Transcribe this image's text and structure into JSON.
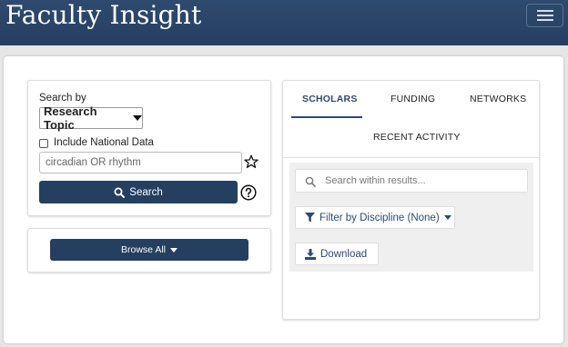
{
  "app": {
    "title": "Faculty Insight"
  },
  "search": {
    "search_by_label": "Search by",
    "search_by_value": "Research Topic",
    "include_national_label": "Include National Data",
    "query_value": "circadian OR rhythm",
    "search_button": "Search"
  },
  "browse": {
    "button": "Browse All"
  },
  "tabs": [
    {
      "label": "SCHOLARS"
    },
    {
      "label": "FUNDING"
    },
    {
      "label": "NETWORKS"
    },
    {
      "label": "RECENT ACTIVITY"
    }
  ],
  "results": {
    "search_placeholder": "Search within results...",
    "filter_button": "Filter by Discipline (None)",
    "download_button": "Download"
  },
  "colors": {
    "brand": "#2e4a6e",
    "primary_button": "#253f60"
  }
}
